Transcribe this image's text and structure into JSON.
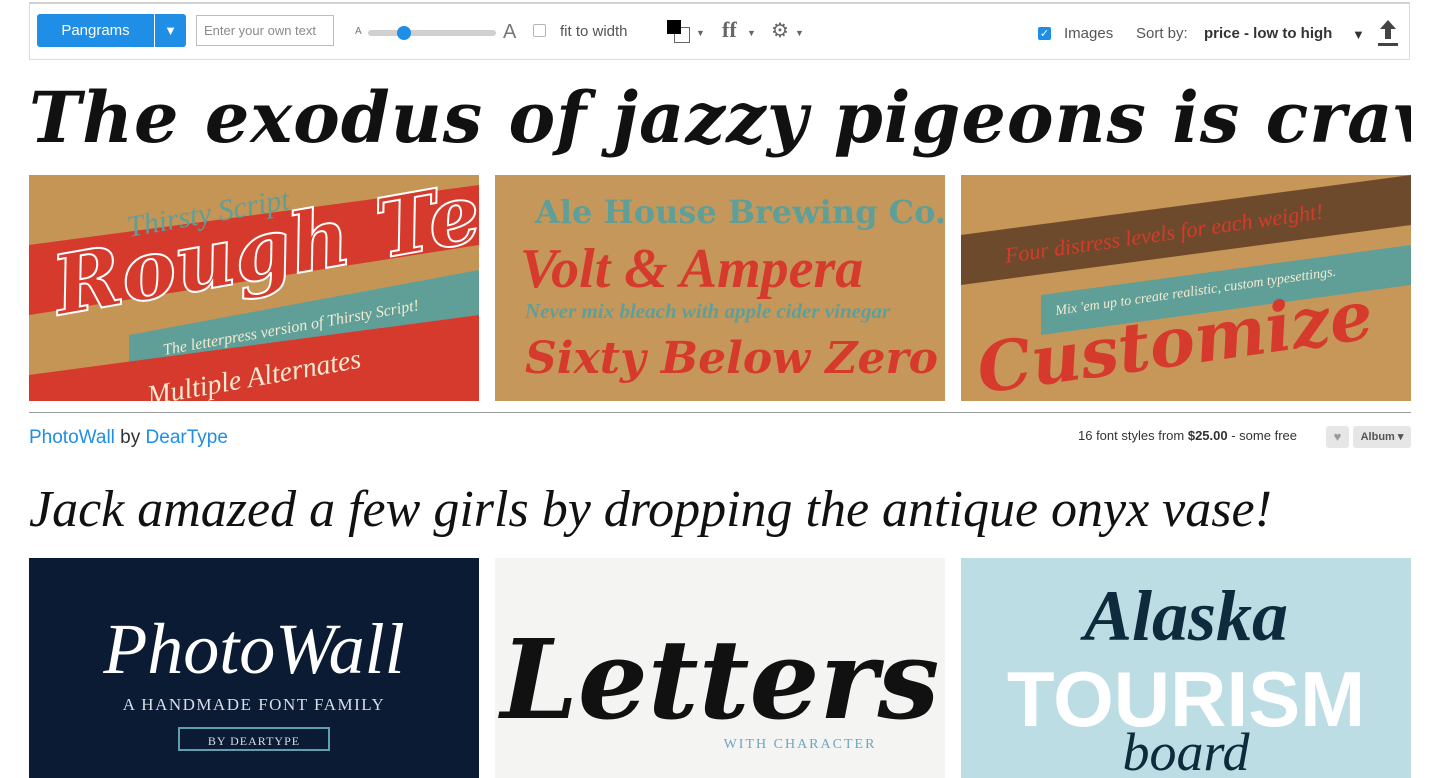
{
  "toolbar": {
    "pangram_label": "Pangrams",
    "pangram_dropdown_glyph": "▼",
    "custom_text_placeholder": "Enter your own text",
    "size_small_label": "A",
    "size_large_label": "A",
    "size_slider_level": 0.28,
    "fit_to_width_label": "fit to width",
    "fit_to_width_checked": false,
    "text_color": "#000000",
    "background_color": "#ffffff",
    "ligatures_glyph": "ff",
    "settings_glyph": "⚙",
    "images_label": "Images",
    "images_checked": true,
    "sort_label": "Sort by:",
    "sort_value": "price - low to high",
    "sort_caret": "▼"
  },
  "results": [
    {
      "sample_text": "The exodus of jazzy pigeons is craved by squ",
      "images": [
        {
          "icon": "thirsty-script-rough-image",
          "line1": "Thirsty Script",
          "line2": "Rough Te",
          "line3": "The letterpress version of Thirsty Script!",
          "line4": "Multiple Alternates"
        },
        {
          "icon": "volt-ampera-image",
          "line1": "Ale House Brewing Co.",
          "line2": "Volt & Ampera",
          "line3": "Never mix bleach with apple cider vinegar",
          "line4": "Sixty Below Zero"
        },
        {
          "icon": "customize-image",
          "line1": "Four distress levels for each weight!",
          "line2": "Mix 'em up to create realistic, custom typesettings.",
          "line3": "Customize"
        }
      ]
    },
    {
      "family_name": "PhotoWall",
      "by_label": "by",
      "designer": "DearType",
      "styles_text": "16 font styles from",
      "price": "$25.00",
      "free_text": "- some free",
      "album_label": "Album ▾",
      "sample_text": "Jack amazed a few girls by dropping the antique onyx vase!",
      "images": [
        {
          "icon": "photowall-image",
          "line1": "PhotoWall",
          "line2": "A HANDMADE FONT FAMILY",
          "line3": "BY DEARTYPE",
          "bg": "#0a1b33"
        },
        {
          "icon": "letters-image",
          "line1": "Letters",
          "line2": "WITH CHARACTER",
          "bg": "#f4f4f2"
        },
        {
          "icon": "alaska-tourism-image",
          "line1": "Alaska",
          "line2": "TOURISM",
          "line3": "board",
          "bg": "#bcdde3"
        }
      ]
    }
  ],
  "colors": {
    "accent": "#1f8ee6",
    "tile_red": "#d63a2c",
    "tile_teal": "#5f9f98",
    "tile_kraft": "#c69758"
  }
}
